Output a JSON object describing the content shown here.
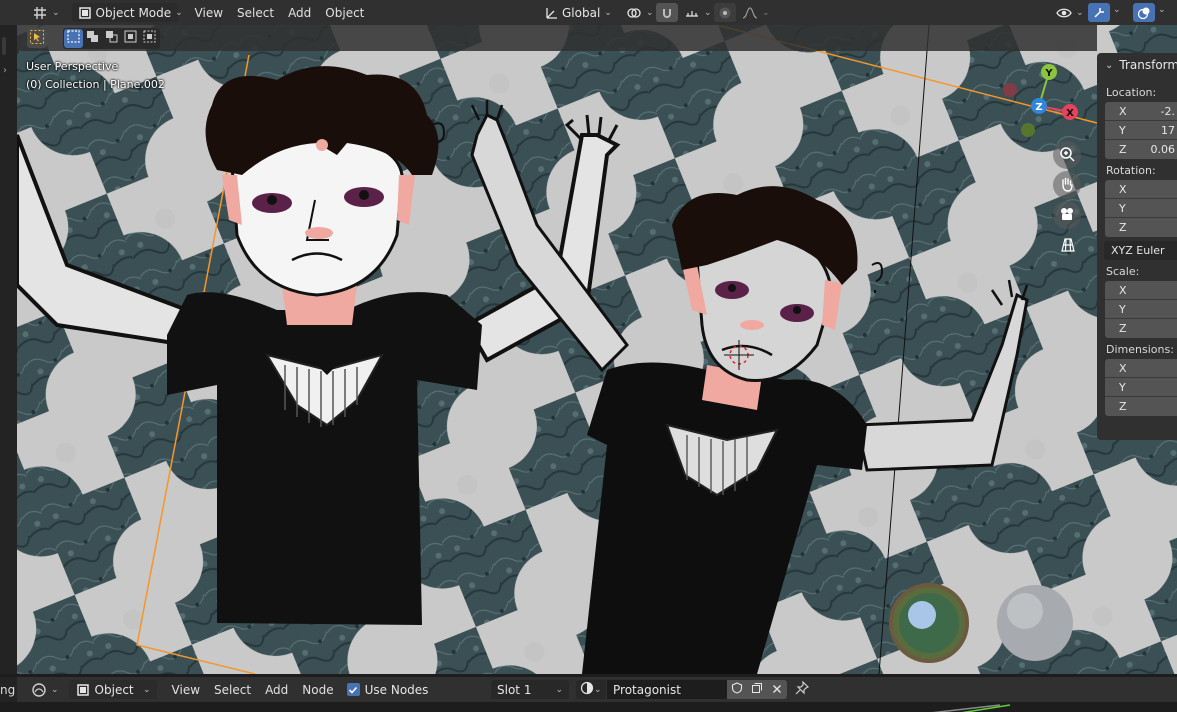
{
  "header": {
    "editor_type_icon": "3d-viewport-icon",
    "mode_label": "Object Mode",
    "menus": [
      "View",
      "Select",
      "Add",
      "Object"
    ],
    "transform_orientation": "Global"
  },
  "viewport": {
    "perspective_label": "User Perspective",
    "collection_label": "(0) Collection | Plane.002",
    "gizmo_axes": [
      "Y",
      "Z",
      "X"
    ]
  },
  "npanel": {
    "title": "Transform",
    "location_label": "Location:",
    "location": [
      {
        "axis": "X",
        "value": "-2."
      },
      {
        "axis": "Y",
        "value": "17"
      },
      {
        "axis": "Z",
        "value": "0.06"
      }
    ],
    "rotation_label": "Rotation:",
    "rotation": [
      {
        "axis": "X",
        "value": ""
      },
      {
        "axis": "Y",
        "value": ""
      },
      {
        "axis": "Z",
        "value": ""
      }
    ],
    "rotation_mode": "XYZ Euler",
    "scale_label": "Scale:",
    "scale": [
      {
        "axis": "X",
        "value": ""
      },
      {
        "axis": "Y",
        "value": ""
      },
      {
        "axis": "Z",
        "value": ""
      }
    ],
    "dimensions_label": "Dimensions:",
    "dimensions": [
      {
        "axis": "X",
        "value": ""
      },
      {
        "axis": "Y",
        "value": ""
      },
      {
        "axis": "Z",
        "value": ""
      }
    ]
  },
  "bottom": {
    "left_clip": "ng",
    "object_label": "Object",
    "menus": [
      "View",
      "Select",
      "Add",
      "Node"
    ],
    "use_nodes_label": "Use Nodes",
    "slot_label": "Slot 1",
    "material_name": "Protagonist"
  },
  "colors": {
    "accent": "#4772b3",
    "header_bg": "#303030",
    "axis_x": "#e4435b",
    "axis_y": "#8bc53f",
    "axis_z": "#2e86de",
    "selection_outline": "#f5962a"
  }
}
